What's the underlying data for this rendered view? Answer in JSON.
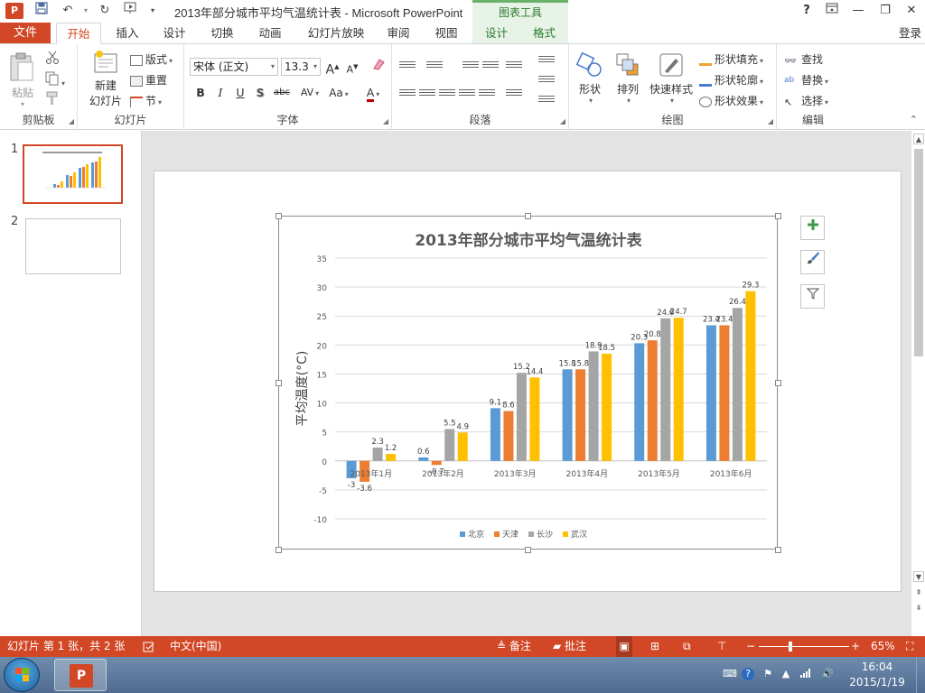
{
  "titlebar": {
    "window_title": "2013年部分城市平均气温统计表 - Microsoft PowerPoint",
    "context_header": "图表工具",
    "help": "?",
    "app_icon_letter": "P",
    "min": "—",
    "restore": "❐",
    "close": "✕"
  },
  "tabs": {
    "file": "文件",
    "items": [
      "开始",
      "插入",
      "设计",
      "切换",
      "动画",
      "幻灯片放映",
      "审阅",
      "视图"
    ],
    "context_items": [
      "设计",
      "格式"
    ],
    "login": "登录"
  },
  "ribbon": {
    "clipboard": {
      "label": "剪贴板",
      "paste": "粘贴"
    },
    "slides": {
      "label": "幻灯片",
      "new_slide_1": "新建",
      "new_slide_2": "幻灯片",
      "layout": "版式",
      "reset": "重置",
      "section": "节"
    },
    "font": {
      "label": "字体",
      "font_name": "宋体 (正文)",
      "font_size": "13.3",
      "bold": "B",
      "italic": "I",
      "underline": "U",
      "shadow": "S",
      "strike": "abc",
      "spacing": "AV",
      "case": "Aa",
      "color": "A",
      "grow": "A",
      "shrink": "A"
    },
    "paragraph": {
      "label": "段落"
    },
    "drawing": {
      "label": "绘图",
      "shape": "形状",
      "arrange": "排列",
      "quick_styles": "快速样式",
      "fill": "形状填充",
      "outline": "形状轮廓",
      "effects": "形状效果"
    },
    "editing": {
      "label": "编辑",
      "find": "查找",
      "replace": "替换",
      "select": "选择"
    },
    "colors": {
      "accent": "#d24726",
      "fill_color": "#f0a030",
      "outline_color": "#4a7cc9"
    }
  },
  "slides_pane": {
    "items": [
      {
        "number": "1"
      },
      {
        "number": "2"
      }
    ]
  },
  "chart_data": {
    "type": "bar",
    "title": "2013年部分城市平均气温统计表",
    "ylabel": "平均温度(°C)",
    "xlabel": "",
    "categories": [
      "2013年1月",
      "2013年2月",
      "2013年3月",
      "2013年4月",
      "2013年5月",
      "2013年6月"
    ],
    "series": [
      {
        "name": "北京",
        "color": "#5b9bd5",
        "values": [
          -3,
          0.6,
          9.1,
          15.8,
          20.3,
          23.4
        ]
      },
      {
        "name": "天津",
        "color": "#ed7d31",
        "values": [
          -3.6,
          -0.7,
          8.6,
          15.8,
          20.8,
          23.4
        ]
      },
      {
        "name": "长沙",
        "color": "#a5a5a5",
        "values": [
          2.3,
          5.5,
          15.2,
          18.9,
          24.6,
          26.4
        ]
      },
      {
        "name": "武汉",
        "color": "#ffc000",
        "values": [
          1.2,
          4.9,
          14.4,
          18.5,
          24.7,
          29.3
        ]
      }
    ],
    "data_labels": [
      [
        "-3",
        "0.6",
        "9.1",
        "15.8",
        "20.3",
        "23.4"
      ],
      [
        "-3.6",
        "-0.7",
        "8.6",
        "15.8",
        "20.8",
        "23.4"
      ],
      [
        "2.3",
        "5.5",
        "15.2",
        "18.9",
        "24.6",
        "26.4"
      ],
      [
        "1.2",
        "4.9",
        "14.4",
        "18.5",
        "24.7",
        "29.3"
      ]
    ],
    "ylim": [
      -10,
      35
    ],
    "yticks": [
      35,
      30,
      25,
      20,
      15,
      10,
      5,
      0,
      -5,
      -10
    ],
    "grid": true,
    "legend": "bottom"
  },
  "chart_tools": {
    "add": "+",
    "style": "brush",
    "filter": "filter"
  },
  "statusbar": {
    "slide_info": "幻灯片 第 1 张，共 2 张",
    "language": "中文(中国)",
    "notes": "备注",
    "comments": "批注",
    "zoom": "65%",
    "zoom_level": 0.65,
    "minus": "−",
    "plus": "+"
  },
  "taskbar": {
    "time": "16:04",
    "date": "2015/1/19",
    "ppt_letter": "P"
  }
}
